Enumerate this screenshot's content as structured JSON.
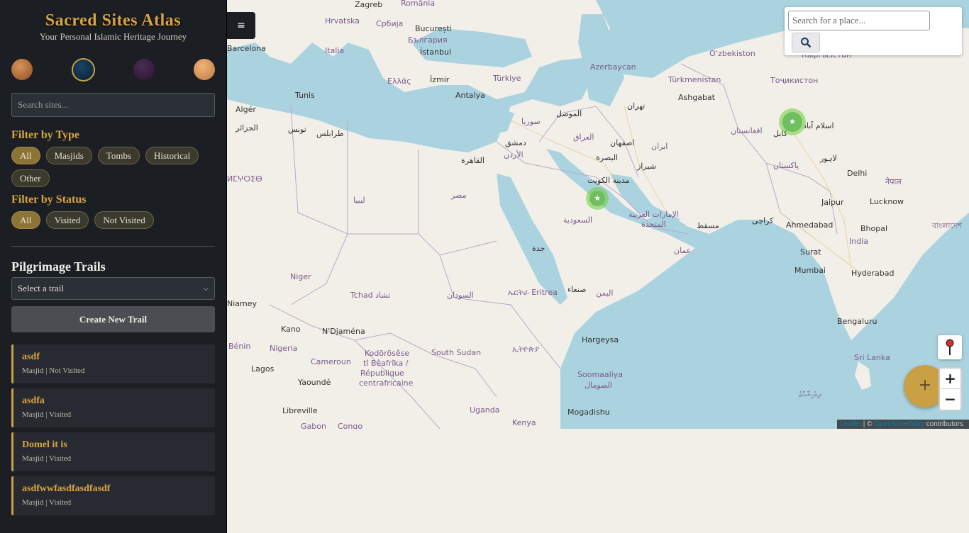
{
  "app": {
    "title": "Sacred Sites Atlas",
    "subtitle": "Your Personal Islamic Heritage Journey"
  },
  "themes": [
    {
      "name": "desert",
      "color": "#b8743a"
    },
    {
      "name": "night",
      "color": "#12304a",
      "selected": true
    },
    {
      "name": "mystic",
      "color": "#3a2240"
    },
    {
      "name": "sand",
      "color": "#d89a5c"
    }
  ],
  "search": {
    "placeholder": "Search sites..."
  },
  "filters": {
    "type_heading": "Filter by Type",
    "types": [
      "All",
      "Masjids",
      "Tombs",
      "Historical",
      "Other"
    ],
    "type_active": "All",
    "status_heading": "Filter by Status",
    "statuses": [
      "All",
      "Visited",
      "Not Visited"
    ],
    "status_active": "All"
  },
  "trails": {
    "heading": "Pilgrimage Trails",
    "select_value": "Select a trail",
    "create_label": "Create New Trail"
  },
  "sites": [
    {
      "name": "asdf",
      "meta": "Masjid | Not Visited"
    },
    {
      "name": "asdfa",
      "meta": "Masjid | Visited"
    },
    {
      "name": "Domel it is",
      "meta": "Masjid | Visited"
    },
    {
      "name": "asdfwwfasdfasdfasdf",
      "meta": "Masjid | Visited"
    }
  ],
  "map": {
    "menu_icon": "≡",
    "geocoder_placeholder": "Search for a place...",
    "geocoder_icon": "search-icon",
    "zoom_in": "+",
    "zoom_out": "−",
    "add_button": "+",
    "locate_icon": "map-pin-icon",
    "attribution_a": "Leaflet",
    "attribution_b": " | © ",
    "attribution_c": "OpenStreetMap",
    "attribution_d": " contributors",
    "marker_glyph": "★",
    "labels": [
      "Zagreb",
      "România",
      "Hrvatska",
      "Србија",
      "București",
      "България",
      "Italia",
      "İstanbul",
      "Türkiye",
      "Ελλάς",
      "İzmir",
      "Antalya",
      "Azerbaycan",
      "Türkmenistan",
      "O‘zbekiston",
      "Ashgabat",
      "Тоҷикистон",
      "Кыргызстан",
      "Algér",
      "الجزائر",
      "طرابلس",
      "ليبيا",
      "مصر",
      "القاهرة",
      "سوريا",
      "دمشق",
      "الأردن",
      "العراق",
      "الموصل",
      "البصرة",
      "تهران",
      "اصفهان",
      "ایران",
      "شيراز",
      "الكويت",
      "السعودية",
      "الإمارات العربية المتحدة",
      "مسقط",
      "عمان",
      "جدة",
      "افغانستان",
      "کابل",
      "اسلام آباد",
      "لاہور",
      "پاکستان",
      "کراچی",
      "Delhi",
      "Jaipur",
      "Lucknow",
      "Ahmedabad",
      "Bhopal",
      "India",
      "Surat",
      "Mumbai",
      "Hyderabad",
      "Bengaluru",
      "Sri Lanka",
      "Niger",
      "Tchad تشاد",
      "السودان",
      "Eritrea",
      "صنعاء",
      "اليمن",
      "Hargeysa",
      "Soomaaliya",
      "الصومال",
      "Nigeria",
      "Kano",
      "N'Djaména",
      "Cameroun",
      "South Sudan",
      "Uganda",
      "Kenya",
      "Mogadishu",
      "Lagos",
      "Yaoundé",
      "Libreville",
      "Bénin",
      "Niamey",
      "Kodörösêse tî Bêafrîka / République centrafricaine",
      "ኢትዮጵያ",
      "Barcelona",
      "Tunis",
      "تونس",
      "ⵍⵎⵖⵔⵉⴱ",
      "Gabon",
      "Congo",
      "नेपाल",
      "বাংলাদেশ",
      "ދިވެހިރާއްޖެ"
    ]
  }
}
